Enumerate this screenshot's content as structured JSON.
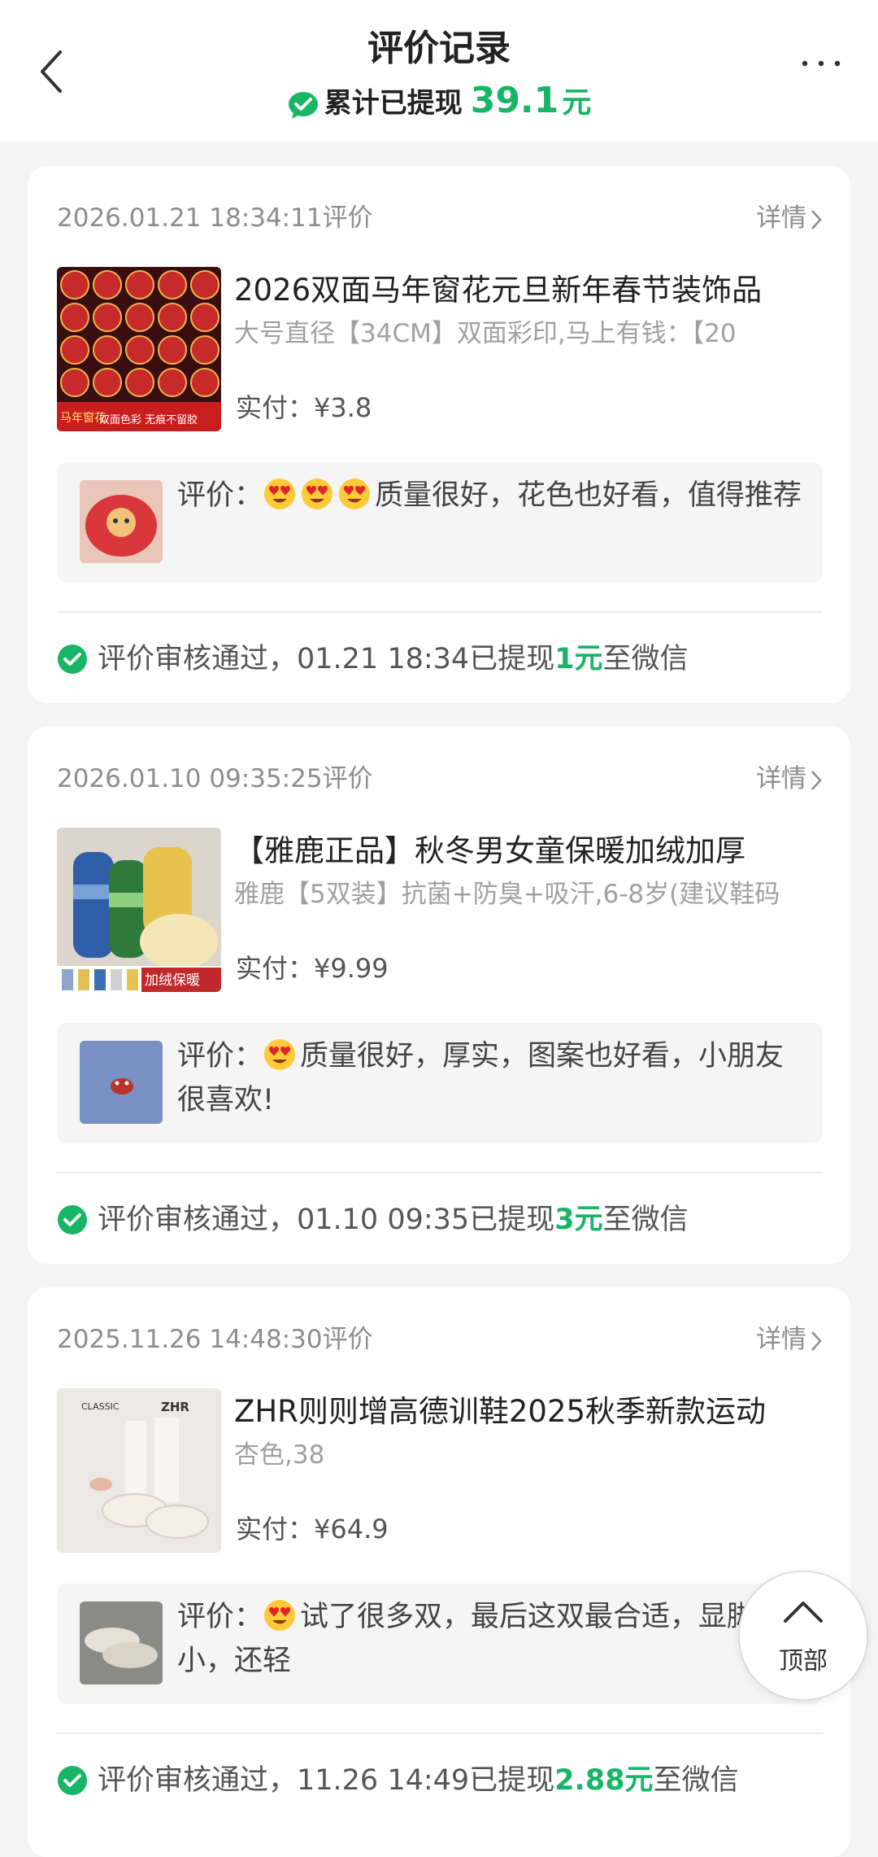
{
  "header": {
    "title": "评价记录",
    "subtitle_prefix": "累计已提现",
    "total_amount": "39.1",
    "total_unit": "元"
  },
  "icons": {
    "back": "chevron-left-icon",
    "more": "more-dots-icon",
    "wechat": "wechat-icon",
    "approved": "check-circle-icon",
    "detail_arrow": "chevron-right-icon",
    "to_top": "chevron-up-icon"
  },
  "colors": {
    "accent": "#18b566",
    "background": "#f4f4f4"
  },
  "records": [
    {
      "date": "2026.01.21 18:34:11评价",
      "detail_label": "详情",
      "product_title": "2026双面马年窗花元旦新年春节装饰品",
      "spec": "大号直径【34CM】双面彩印,马上有钱：【20",
      "price_label": "实付：",
      "price": "¥3.8",
      "review_label": "评价：",
      "review_text": "质量很好，花色也好看，值得推荐",
      "emoji_count": 3,
      "status_text": "评价审核通过，01.21 18:34已提现",
      "amount": "1元",
      "status_suffix": "至微信",
      "thumb_badge_1": "马年窗花",
      "thumb_badge_2": "双面色彩 无痕不留胶"
    },
    {
      "date": "2026.01.10 09:35:25评价",
      "detail_label": "详情",
      "product_title": "【雅鹿正品】秋冬男女童保暖加绒加厚",
      "spec": "雅鹿【5双装】抗菌+防臭+吸汗,6-8岁(建议鞋码",
      "price_label": "实付：",
      "price": "¥9.99",
      "review_label": "评价：",
      "review_text": "质量很好，厚实，图案也好看，小朋友很喜欢!",
      "emoji_count": 1,
      "status_text": "评价审核通过，01.10 09:35已提现",
      "amount": "3元",
      "status_suffix": "至微信",
      "thumb_badge_1": "加绒保暖"
    },
    {
      "date": "2025.11.26 14:48:30评价",
      "detail_label": "详情",
      "product_title": "ZHR则则增高德训鞋2025秋季新款运动",
      "spec": "杏色,38",
      "price_label": "实付：",
      "price": "¥64.9",
      "review_label": "评价：",
      "review_text": "试了很多双，最后这双最合适，显脚小，还轻",
      "emoji_count": 1,
      "status_text": "评价审核通过，11.26 14:49已提现",
      "amount": "2.88元",
      "status_suffix": "至微信",
      "thumb_badge_1": "CLASSIC",
      "thumb_badge_2": "ZHR"
    }
  ],
  "to_top_label": "顶部"
}
